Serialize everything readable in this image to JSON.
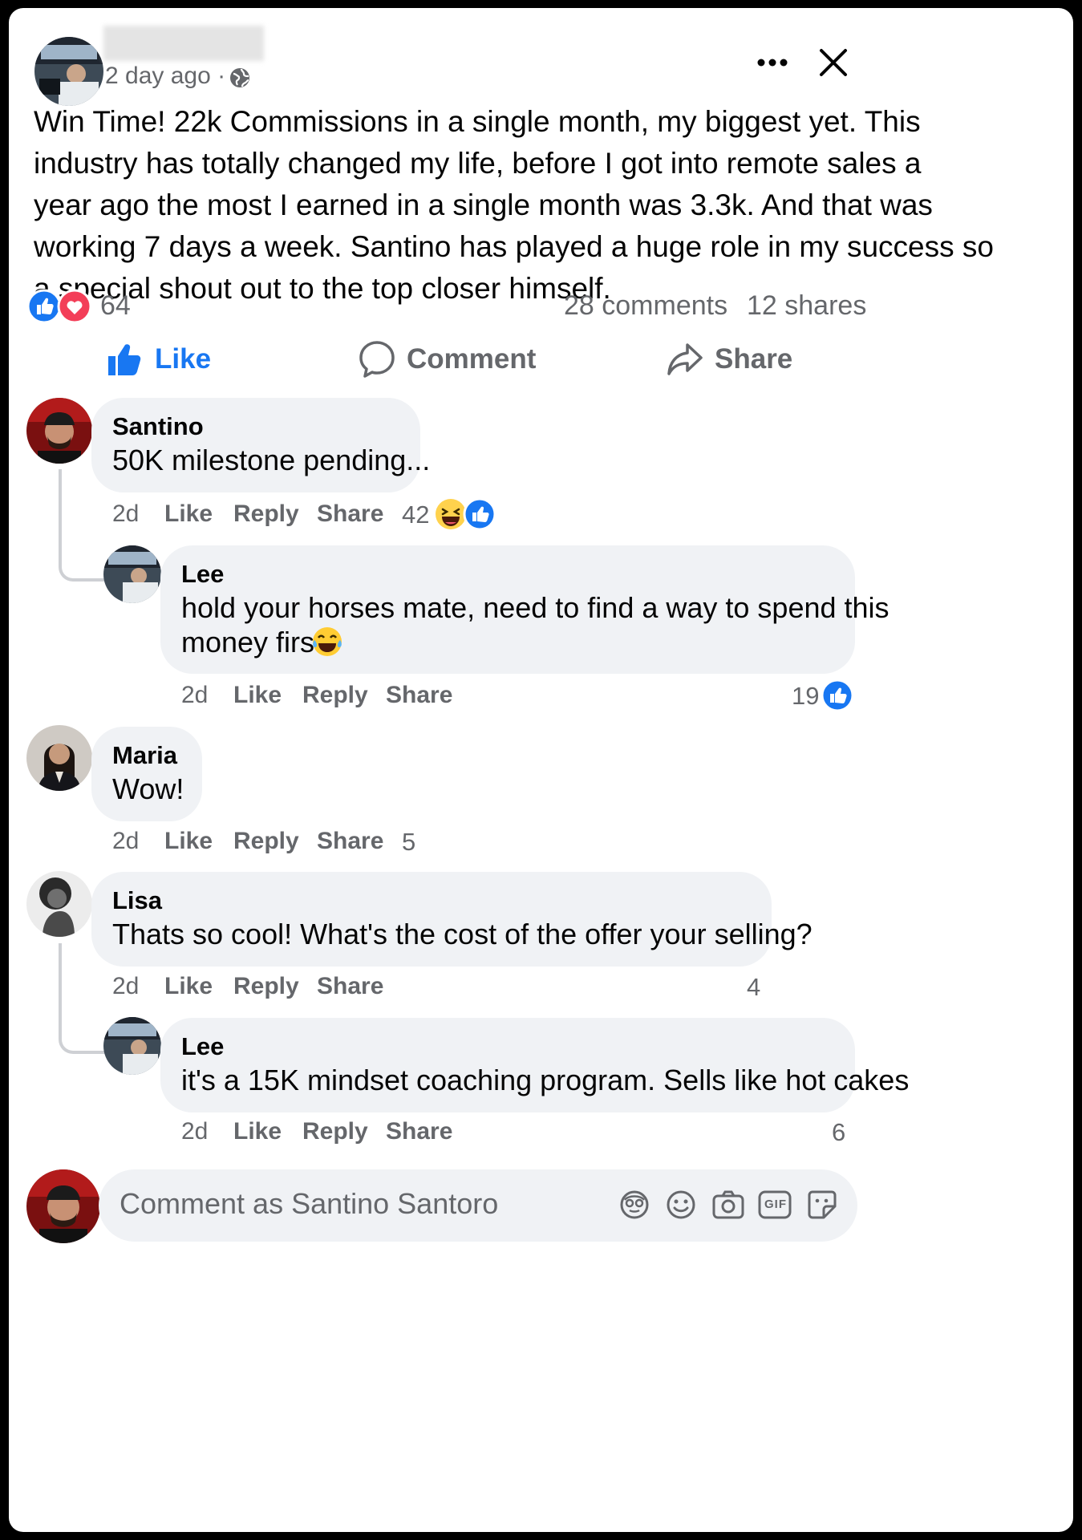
{
  "post": {
    "time": "2 day ago",
    "separator": "·",
    "text_lines": [
      "Win Time! 22k Commissions in a single month, my biggest yet. This",
      "industry has totally changed my life, before I got into remote sales a",
      "year ago the most I earned in a single month was 3.3k. And that was",
      "working 7 days a week. Santino has played a huge role in my success so",
      "a special shout out to the top closer himself."
    ],
    "reaction_count": "64",
    "comments_count": "28 comments",
    "shares_count": "12 shares"
  },
  "actions": {
    "like": "Like",
    "comment": "Comment",
    "share": "Share"
  },
  "comments": [
    {
      "name": "Santino",
      "text": "50K milestone pending...",
      "time": "2d",
      "like": "Like",
      "reply": "Reply",
      "share": "Share",
      "reactions": "42"
    },
    {
      "name": "Lee",
      "text_lines": [
        "hold your horses mate, need to find a way to spend this",
        "money first"
      ],
      "time": "2d",
      "like": "Like",
      "reply": "Reply",
      "share": "Share",
      "reactions": "19"
    },
    {
      "name": "Maria",
      "text": "Wow!",
      "time": "2d",
      "like": "Like",
      "reply": "Reply",
      "share": "Share",
      "reactions": "5"
    },
    {
      "name": "Lisa",
      "text": "Thats so cool! What's the cost of the offer your selling?",
      "time": "2d",
      "like": "Like",
      "reply": "Reply",
      "share": "Share",
      "reactions": "4"
    },
    {
      "name": "Lee",
      "text": "it's a 15K mindset coaching program. Sells like hot cakes",
      "time": "2d",
      "like": "Like",
      "reply": "Reply",
      "share": "Share",
      "reactions": "6"
    }
  ],
  "composer": {
    "placeholder": "Comment as Santino Santoro",
    "gif": "GIF"
  },
  "colors": {
    "accent": "#1877f2",
    "love": "#f33e58",
    "muted": "#65676b",
    "bubble": "#f0f2f5"
  },
  "icons": [
    "globe-icon",
    "more-icon",
    "close-icon",
    "like-icon",
    "comment-icon",
    "share-icon",
    "avatar-icon",
    "emoji-icon",
    "camera-icon",
    "gif-icon",
    "sticker-icon"
  ]
}
